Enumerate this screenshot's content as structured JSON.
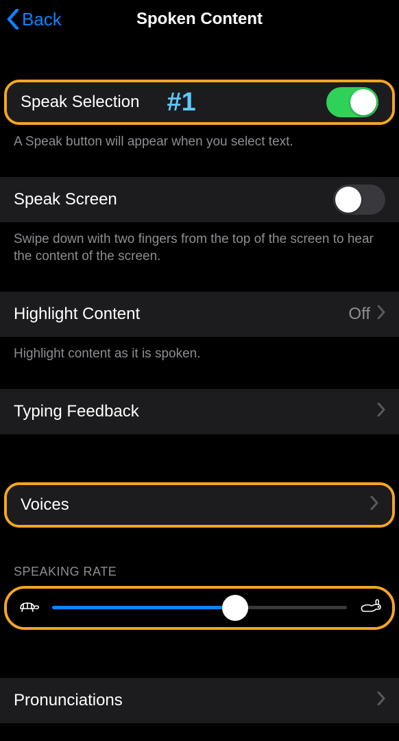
{
  "nav": {
    "back": "Back",
    "title": "Spoken Content"
  },
  "rows": {
    "speakSelection": {
      "label": "Speak Selection",
      "annotation": "#1",
      "footer": "A Speak button will appear when you select text.",
      "on": true
    },
    "speakScreen": {
      "label": "Speak Screen",
      "footer": "Swipe down with two fingers from the top of the screen to hear the content of the screen.",
      "on": false
    },
    "highlight": {
      "label": "Highlight Content",
      "value": "Off",
      "footer": "Highlight content as it is spoken."
    },
    "typingFeedback": {
      "label": "Typing Feedback"
    },
    "voices": {
      "label": "Voices"
    },
    "speakingRate": {
      "header": "SPEAKING RATE",
      "percent": 62
    },
    "pronunciations": {
      "label": "Pronunciations"
    }
  }
}
